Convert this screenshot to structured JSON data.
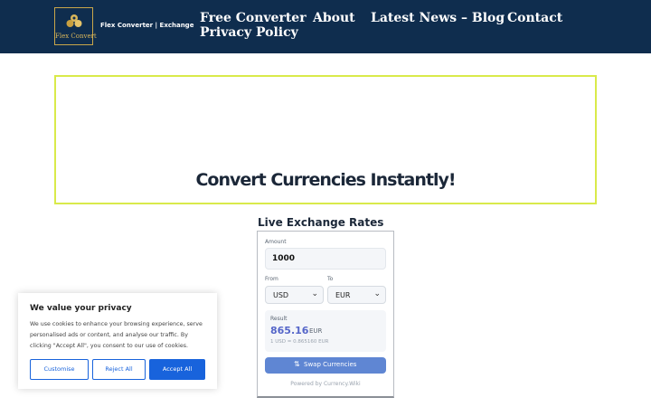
{
  "header": {
    "logo_text": "Flex Convert",
    "brand": "Flex Converter | Exchange",
    "nav": [
      {
        "label": "Free Converter"
      },
      {
        "label": "About"
      },
      {
        "label": "Latest News – Blog"
      },
      {
        "label": "Contact"
      },
      {
        "label": "Privacy Policy"
      }
    ],
    "logo_color": "#d9b65a",
    "bg_color": "#0f2d4e"
  },
  "hero": {
    "title": "Convert Currencies Instantly!",
    "border_color": "#d9ea4a"
  },
  "rates": {
    "title": "Live Exchange Rates",
    "amount_label": "Amount",
    "amount_value": "1000",
    "from_label": "From",
    "to_label": "To",
    "from_value": "USD",
    "to_value": "EUR",
    "result_label": "Result",
    "result_value": "865.16",
    "result_currency": "EUR",
    "rate_line": "1 USD = 0.865160 EUR",
    "swap_label": "Swap Currencies",
    "swap_icon": "swap-arrows-icon",
    "powered_by": "Powered by Currency.Wiki",
    "accent_color": "#5566c9"
  },
  "cookie": {
    "title": "We value your privacy",
    "text": "We use cookies to enhance your browsing experience, serve personalised ads or content, and analyse our traffic. By clicking \"Accept All\", you consent to our use of cookies.",
    "customise": "Customise",
    "reject": "Reject All",
    "accept": "Accept All",
    "button_color": "#1863dc"
  }
}
